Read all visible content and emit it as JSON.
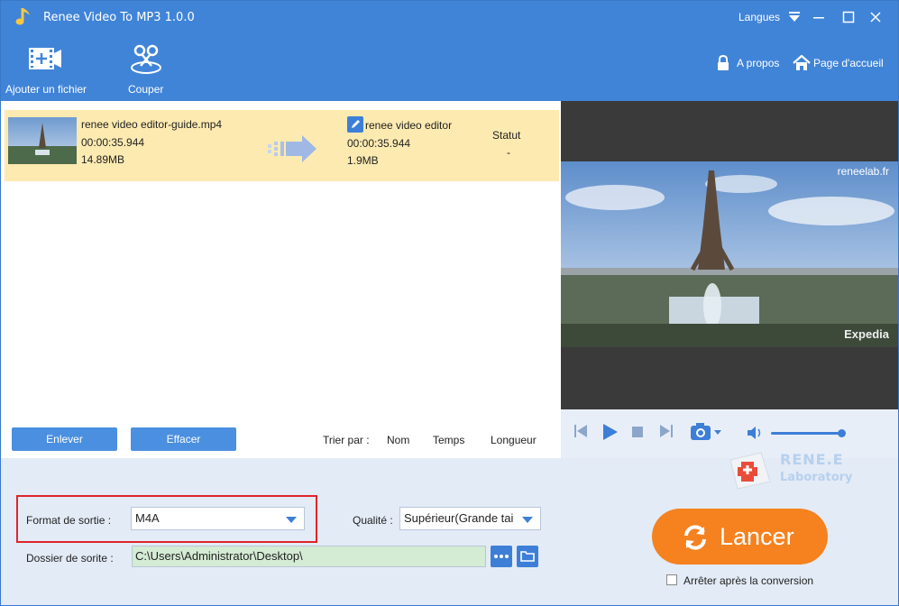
{
  "app": {
    "title": "Renee Video To MP3 1.0.0",
    "language_label": "Langues"
  },
  "toolbar": {
    "add_file_label": "Ajouter un fichier",
    "cut_label": "Couper",
    "about_label": "A propos",
    "home_label": "Page d'accueil"
  },
  "file_list": {
    "rows": [
      {
        "source": {
          "name": "renee video editor-guide.mp4",
          "duration": "00:00:35.944",
          "size": "14.89MB"
        },
        "output": {
          "name": "renee video editor",
          "duration": "00:00:35.944",
          "size": "1.9MB"
        },
        "status_header": "Statut",
        "status_value": "-"
      }
    ],
    "remove_label": "Enlever",
    "clear_label": "Effacer",
    "sort_label": "Trier par :",
    "sort_options": [
      "Nom",
      "Temps",
      "Longueur"
    ]
  },
  "preview": {
    "watermark": "reneelab.fr",
    "brand": "Expedia",
    "volume_level": 0.95
  },
  "logo": {
    "line1": "RENE.E",
    "line2": "Laboratory"
  },
  "output": {
    "format_label": "Format de sortie :",
    "format_value": "M4A",
    "quality_label": "Qualité :",
    "quality_value": "Supérieur(Grande tai",
    "folder_label": "Dossier de sorite :",
    "folder_value": "C:\\Users\\Administrator\\Desktop\\",
    "launch_label": "Lancer",
    "stop_after_label": "Arrêter après la conversion"
  },
  "colors": {
    "accent": "#4084d8",
    "launch": "#f5821f",
    "row_highlight": "#fdeab0",
    "format_border": "#e0242b"
  }
}
